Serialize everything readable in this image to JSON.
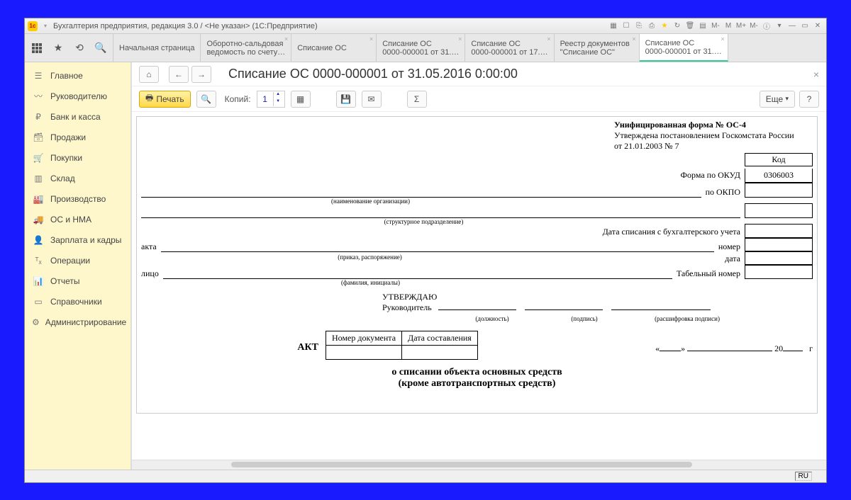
{
  "window": {
    "title": "Бухгалтерия предприятия, редакция 3.0 / <Не указан>  (1С:Предприятие)"
  },
  "tabs": [
    {
      "l1": "Начальная страница",
      "l2": ""
    },
    {
      "l1": "Оборотно-сальдовая",
      "l2": "ведомость по счету…"
    },
    {
      "l1": "Списание ОС",
      "l2": ""
    },
    {
      "l1": "Списание ОС",
      "l2": "0000-000001 от 31.…"
    },
    {
      "l1": "Списание ОС",
      "l2": "0000-000001 от 17.…"
    },
    {
      "l1": "Реестр документов",
      "l2": "\"Списание ОС\""
    },
    {
      "l1": "Списание ОС",
      "l2": "0000-000001 от 31.…"
    }
  ],
  "sidebar": {
    "items": [
      {
        "label": "Главное"
      },
      {
        "label": "Руководителю"
      },
      {
        "label": "Банк и касса"
      },
      {
        "label": "Продажи"
      },
      {
        "label": "Покупки"
      },
      {
        "label": "Склад"
      },
      {
        "label": "Производство"
      },
      {
        "label": "ОС и НМА"
      },
      {
        "label": "Зарплата и кадры"
      },
      {
        "label": "Операции"
      },
      {
        "label": "Отчеты"
      },
      {
        "label": "Справочники"
      },
      {
        "label": "Администрирование"
      }
    ]
  },
  "doc": {
    "title": "Списание ОС 0000-000001 от 31.05.2016 0:00:00",
    "toolbar": {
      "print": "Печать",
      "copies_label": "Копий:",
      "copies_value": "1",
      "more": "Еще",
      "help": "?"
    },
    "form": {
      "header1": "Унифицированная форма № ОС-4",
      "header2": "Утверждена постановлением Госкомстата России",
      "header3": "от 21.01.2003 № 7",
      "kod_head": "Код",
      "okud_label": "Форма по ОКУД",
      "okud_value": "0306003",
      "okpo_label": "по ОКПО",
      "org_hint": "(наименование организации)",
      "dept_hint": "(структурное подразделение)",
      "date_off_label": "Дата списания с бухгалтерского учета",
      "akta": "акта",
      "order_hint": "(приказ, распоряжение)",
      "number": "номер",
      "date": "дата",
      "litso": "лицо",
      "fio_hint": "(фамилия, инициалы)",
      "tab_num": "Табельный номер",
      "approve": "УТВЕРЖДАЮ",
      "ruk": "Руководитель",
      "pos_hint": "(должность)",
      "sign_hint": "(подпись)",
      "decode_hint": "(расшифровка подписи)",
      "doc_num_head": "Номер документа",
      "doc_date_head": "Дата составления",
      "akt": "АКТ",
      "akt_line1": "о списании объекта основных средств",
      "akt_line2": "(кроме автотранспортных средств)",
      "quote_l": "«",
      "quote_r": "»",
      "year20": "20",
      "year_g": "г"
    }
  },
  "status": {
    "lang": "RU"
  }
}
